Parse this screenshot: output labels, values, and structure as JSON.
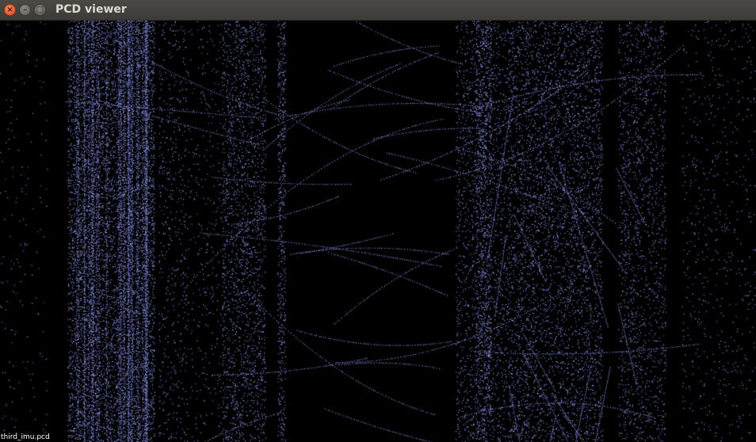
{
  "window": {
    "title": "PCD viewer",
    "close_glyph": "×",
    "minimize_glyph": "–",
    "maximize_glyph": "□"
  },
  "viewer": {
    "file_label": "third_imu.pcd",
    "point_color": "#7f86d8",
    "background_color": "#000000"
  },
  "icons": {
    "close": "close-icon",
    "minimize": "minimize-icon",
    "maximize": "maximize-icon"
  }
}
